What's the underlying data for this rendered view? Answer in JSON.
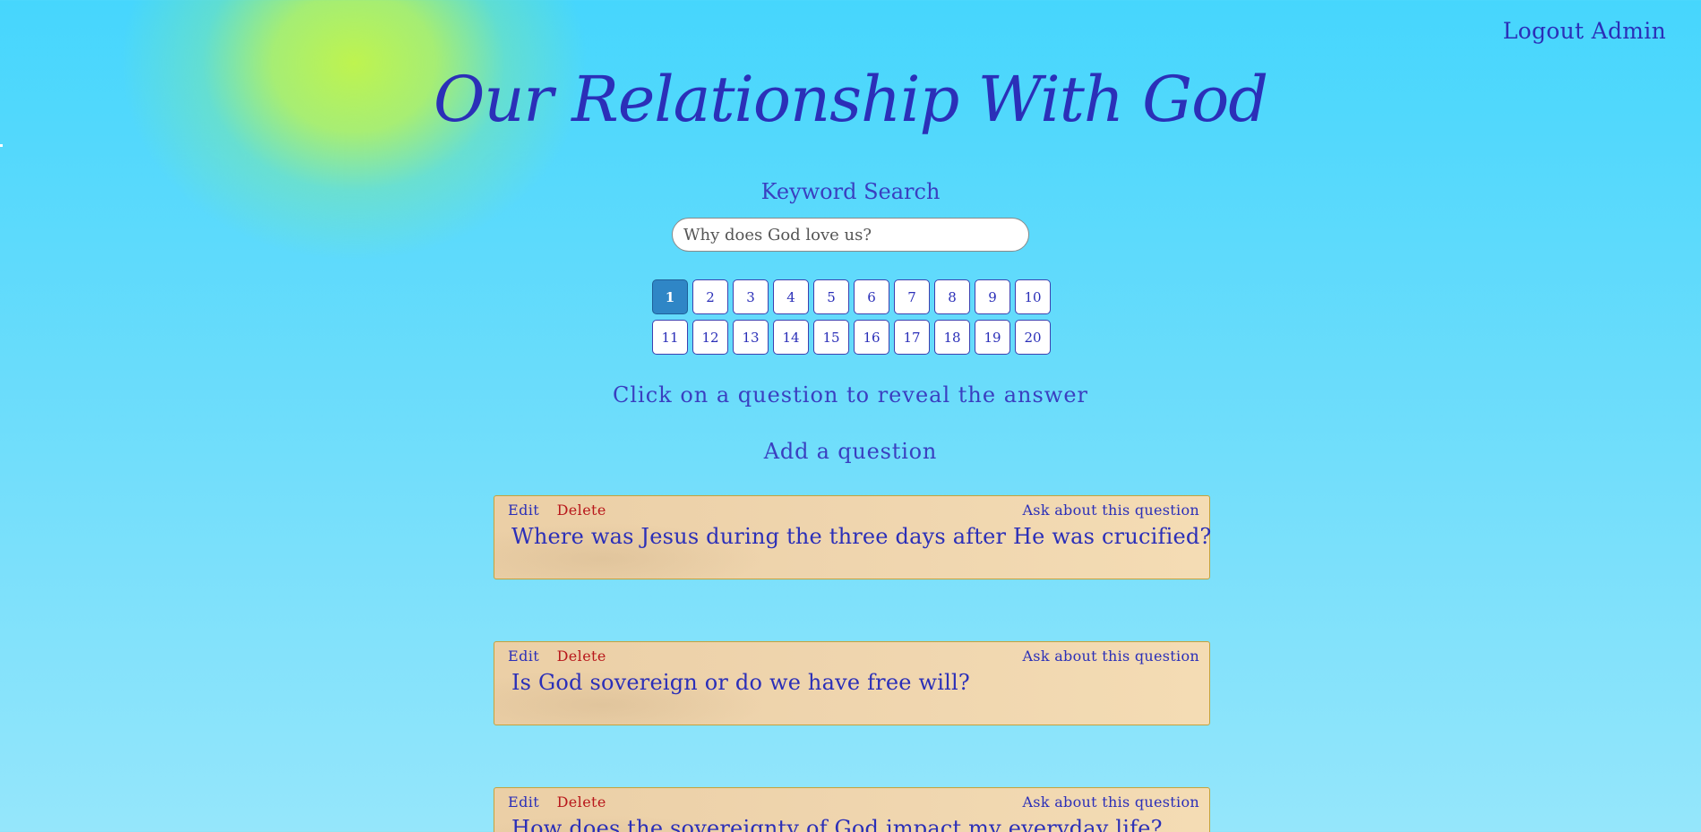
{
  "header": {
    "logout_label": "Logout Admin",
    "title": "Our Relationship With God"
  },
  "search": {
    "label": "Keyword Search",
    "placeholder": "Why does God love us?"
  },
  "pagination": {
    "current_page": "1",
    "rows": [
      [
        "1",
        "2",
        "3",
        "4",
        "5",
        "6",
        "7",
        "8",
        "9",
        "10"
      ],
      [
        "11",
        "12",
        "13",
        "14",
        "15",
        "16",
        "17",
        "18",
        "19",
        "20"
      ]
    ]
  },
  "instructions": {
    "hint": "Click on a question to reveal the answer",
    "add_question_label": "Add a question"
  },
  "card_labels": {
    "edit": "Edit",
    "delete": "Delete",
    "ask": "Ask about this question"
  },
  "questions": [
    {
      "text": "Where was Jesus during the three days after He was crucified?"
    },
    {
      "text": "Is God sovereign or do we have free will?"
    },
    {
      "text": "How does the sovereignty of God impact my everyday life?"
    }
  ],
  "colors": {
    "text_primary": "#2b2fb8",
    "delete_red": "#b8171b",
    "active_page": "#2f86c6",
    "card_background": "#efd5ae",
    "card_border": "#c5a23a",
    "background_blue": "#46d6fd",
    "background_glow": "#c4f546"
  }
}
